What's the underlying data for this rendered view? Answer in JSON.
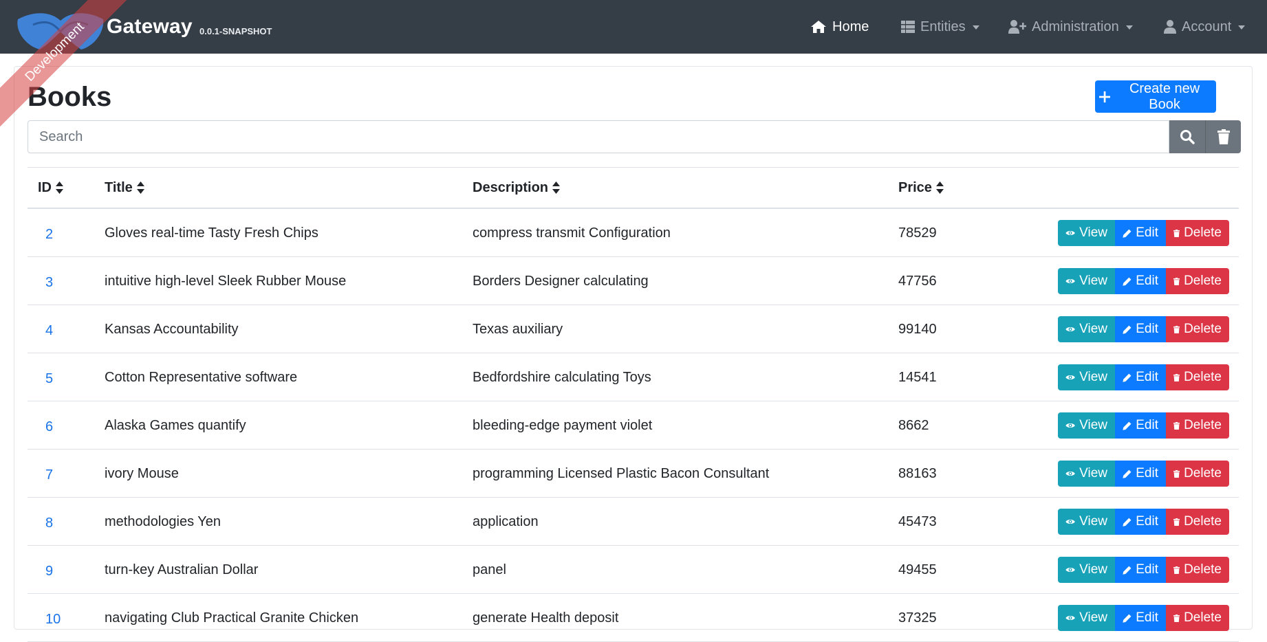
{
  "navbar": {
    "brand_title": "Gateway",
    "brand_version": "0.0.1-SNAPSHOT",
    "ribbon_text": "Development",
    "items": [
      {
        "label": "Home",
        "icon": "home-icon",
        "active": true
      },
      {
        "label": "Entities",
        "icon": "table-icon",
        "dropdown": true
      },
      {
        "label": "Administration",
        "icon": "user-plus-icon",
        "dropdown": true
      },
      {
        "label": "Account",
        "icon": "user-icon",
        "dropdown": true
      }
    ]
  },
  "page": {
    "title": "Books",
    "create_button_label": "Create new Book",
    "search_placeholder": "Search",
    "search_value": ""
  },
  "table": {
    "columns": [
      "ID",
      "Title",
      "Description",
      "Price"
    ],
    "actions": {
      "view": "View",
      "edit": "Edit",
      "delete": "Delete"
    },
    "rows": [
      {
        "id": "2",
        "title": "Gloves real-time Tasty Fresh Chips",
        "description": "compress transmit Configuration",
        "price": "78529"
      },
      {
        "id": "3",
        "title": "intuitive high-level Sleek Rubber Mouse",
        "description": "Borders Designer calculating",
        "price": "47756"
      },
      {
        "id": "4",
        "title": "Kansas Accountability",
        "description": "Texas auxiliary",
        "price": "99140"
      },
      {
        "id": "5",
        "title": "Cotton Representative software",
        "description": "Bedfordshire calculating Toys",
        "price": "14541"
      },
      {
        "id": "6",
        "title": "Alaska Games quantify",
        "description": "bleeding-edge payment violet",
        "price": "8662"
      },
      {
        "id": "7",
        "title": "ivory Mouse",
        "description": "programming Licensed Plastic Bacon Consultant",
        "price": "88163"
      },
      {
        "id": "8",
        "title": "methodologies Yen",
        "description": "application",
        "price": "45473"
      },
      {
        "id": "9",
        "title": "turn-key Australian Dollar",
        "description": "panel",
        "price": "49455"
      },
      {
        "id": "10",
        "title": "navigating Club Practical Granite Chicken",
        "description": "generate Health deposit",
        "price": "37325"
      }
    ]
  },
  "colors": {
    "navbar_bg": "#353d47",
    "primary": "#0d7bff",
    "info": "#17a2b8",
    "danger": "#dc3545",
    "secondary": "#6c757d",
    "link": "#1a73e8"
  }
}
